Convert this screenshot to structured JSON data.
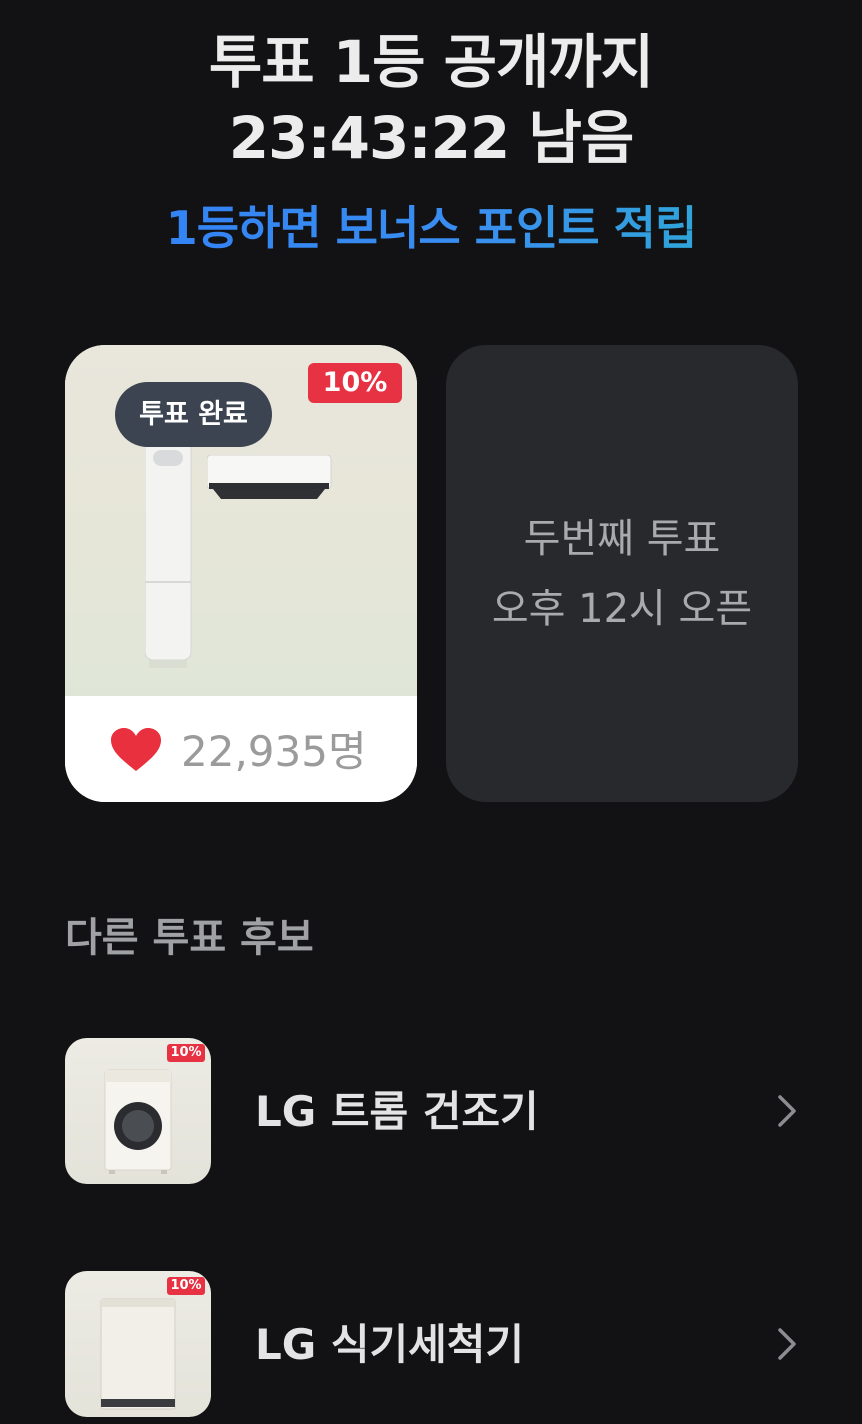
{
  "header": {
    "line1": "투표 1등 공개까지",
    "line2": "23:43:22 남음",
    "bonus": "1등하면 보너스 포인트 적립"
  },
  "current_vote": {
    "discount": "10%",
    "status": "투표 완료",
    "votes": "22,935명"
  },
  "next_vote": {
    "line1": "두번째 투표",
    "line2": "오후 12시 오픈"
  },
  "others": {
    "title": "다른 투표 후보",
    "items": [
      {
        "label": "LG 트롬 건조기",
        "discount": "10%"
      },
      {
        "label": "LG 식기세척기",
        "discount": "10%"
      }
    ]
  },
  "colors": {
    "background": "#121214",
    "discount": "#e63242",
    "heart": "#e8303e",
    "bonus_start": "#2f7df6",
    "bonus_end": "#28b5c9"
  }
}
